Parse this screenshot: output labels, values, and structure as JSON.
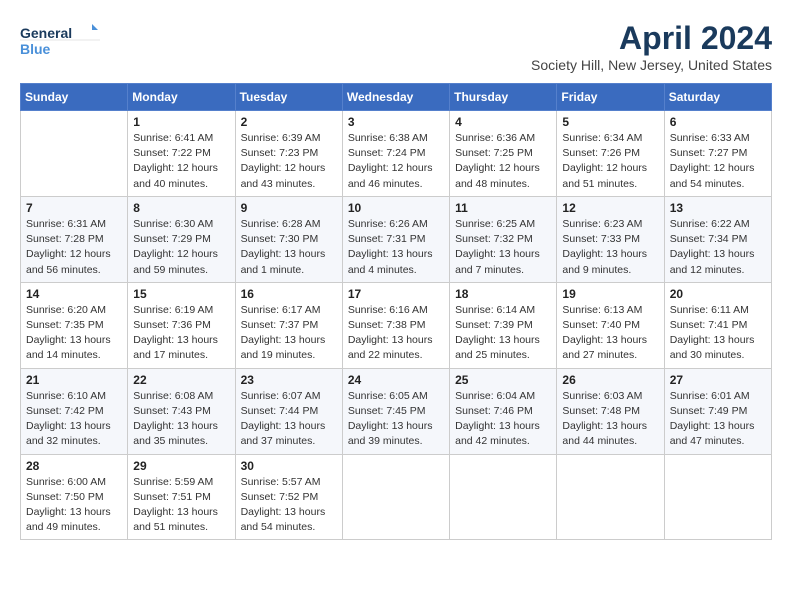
{
  "logo": {
    "line1": "General",
    "line2": "Blue"
  },
  "title": "April 2024",
  "subtitle": "Society Hill, New Jersey, United States",
  "header_days": [
    "Sunday",
    "Monday",
    "Tuesday",
    "Wednesday",
    "Thursday",
    "Friday",
    "Saturday"
  ],
  "weeks": [
    [
      {
        "num": "",
        "info": ""
      },
      {
        "num": "1",
        "info": "Sunrise: 6:41 AM\nSunset: 7:22 PM\nDaylight: 12 hours\nand 40 minutes."
      },
      {
        "num": "2",
        "info": "Sunrise: 6:39 AM\nSunset: 7:23 PM\nDaylight: 12 hours\nand 43 minutes."
      },
      {
        "num": "3",
        "info": "Sunrise: 6:38 AM\nSunset: 7:24 PM\nDaylight: 12 hours\nand 46 minutes."
      },
      {
        "num": "4",
        "info": "Sunrise: 6:36 AM\nSunset: 7:25 PM\nDaylight: 12 hours\nand 48 minutes."
      },
      {
        "num": "5",
        "info": "Sunrise: 6:34 AM\nSunset: 7:26 PM\nDaylight: 12 hours\nand 51 minutes."
      },
      {
        "num": "6",
        "info": "Sunrise: 6:33 AM\nSunset: 7:27 PM\nDaylight: 12 hours\nand 54 minutes."
      }
    ],
    [
      {
        "num": "7",
        "info": "Sunrise: 6:31 AM\nSunset: 7:28 PM\nDaylight: 12 hours\nand 56 minutes."
      },
      {
        "num": "8",
        "info": "Sunrise: 6:30 AM\nSunset: 7:29 PM\nDaylight: 12 hours\nand 59 minutes."
      },
      {
        "num": "9",
        "info": "Sunrise: 6:28 AM\nSunset: 7:30 PM\nDaylight: 13 hours\nand 1 minute."
      },
      {
        "num": "10",
        "info": "Sunrise: 6:26 AM\nSunset: 7:31 PM\nDaylight: 13 hours\nand 4 minutes."
      },
      {
        "num": "11",
        "info": "Sunrise: 6:25 AM\nSunset: 7:32 PM\nDaylight: 13 hours\nand 7 minutes."
      },
      {
        "num": "12",
        "info": "Sunrise: 6:23 AM\nSunset: 7:33 PM\nDaylight: 13 hours\nand 9 minutes."
      },
      {
        "num": "13",
        "info": "Sunrise: 6:22 AM\nSunset: 7:34 PM\nDaylight: 13 hours\nand 12 minutes."
      }
    ],
    [
      {
        "num": "14",
        "info": "Sunrise: 6:20 AM\nSunset: 7:35 PM\nDaylight: 13 hours\nand 14 minutes."
      },
      {
        "num": "15",
        "info": "Sunrise: 6:19 AM\nSunset: 7:36 PM\nDaylight: 13 hours\nand 17 minutes."
      },
      {
        "num": "16",
        "info": "Sunrise: 6:17 AM\nSunset: 7:37 PM\nDaylight: 13 hours\nand 19 minutes."
      },
      {
        "num": "17",
        "info": "Sunrise: 6:16 AM\nSunset: 7:38 PM\nDaylight: 13 hours\nand 22 minutes."
      },
      {
        "num": "18",
        "info": "Sunrise: 6:14 AM\nSunset: 7:39 PM\nDaylight: 13 hours\nand 25 minutes."
      },
      {
        "num": "19",
        "info": "Sunrise: 6:13 AM\nSunset: 7:40 PM\nDaylight: 13 hours\nand 27 minutes."
      },
      {
        "num": "20",
        "info": "Sunrise: 6:11 AM\nSunset: 7:41 PM\nDaylight: 13 hours\nand 30 minutes."
      }
    ],
    [
      {
        "num": "21",
        "info": "Sunrise: 6:10 AM\nSunset: 7:42 PM\nDaylight: 13 hours\nand 32 minutes."
      },
      {
        "num": "22",
        "info": "Sunrise: 6:08 AM\nSunset: 7:43 PM\nDaylight: 13 hours\nand 35 minutes."
      },
      {
        "num": "23",
        "info": "Sunrise: 6:07 AM\nSunset: 7:44 PM\nDaylight: 13 hours\nand 37 minutes."
      },
      {
        "num": "24",
        "info": "Sunrise: 6:05 AM\nSunset: 7:45 PM\nDaylight: 13 hours\nand 39 minutes."
      },
      {
        "num": "25",
        "info": "Sunrise: 6:04 AM\nSunset: 7:46 PM\nDaylight: 13 hours\nand 42 minutes."
      },
      {
        "num": "26",
        "info": "Sunrise: 6:03 AM\nSunset: 7:48 PM\nDaylight: 13 hours\nand 44 minutes."
      },
      {
        "num": "27",
        "info": "Sunrise: 6:01 AM\nSunset: 7:49 PM\nDaylight: 13 hours\nand 47 minutes."
      }
    ],
    [
      {
        "num": "28",
        "info": "Sunrise: 6:00 AM\nSunset: 7:50 PM\nDaylight: 13 hours\nand 49 minutes."
      },
      {
        "num": "29",
        "info": "Sunrise: 5:59 AM\nSunset: 7:51 PM\nDaylight: 13 hours\nand 51 minutes."
      },
      {
        "num": "30",
        "info": "Sunrise: 5:57 AM\nSunset: 7:52 PM\nDaylight: 13 hours\nand 54 minutes."
      },
      {
        "num": "",
        "info": ""
      },
      {
        "num": "",
        "info": ""
      },
      {
        "num": "",
        "info": ""
      },
      {
        "num": "",
        "info": ""
      }
    ]
  ]
}
